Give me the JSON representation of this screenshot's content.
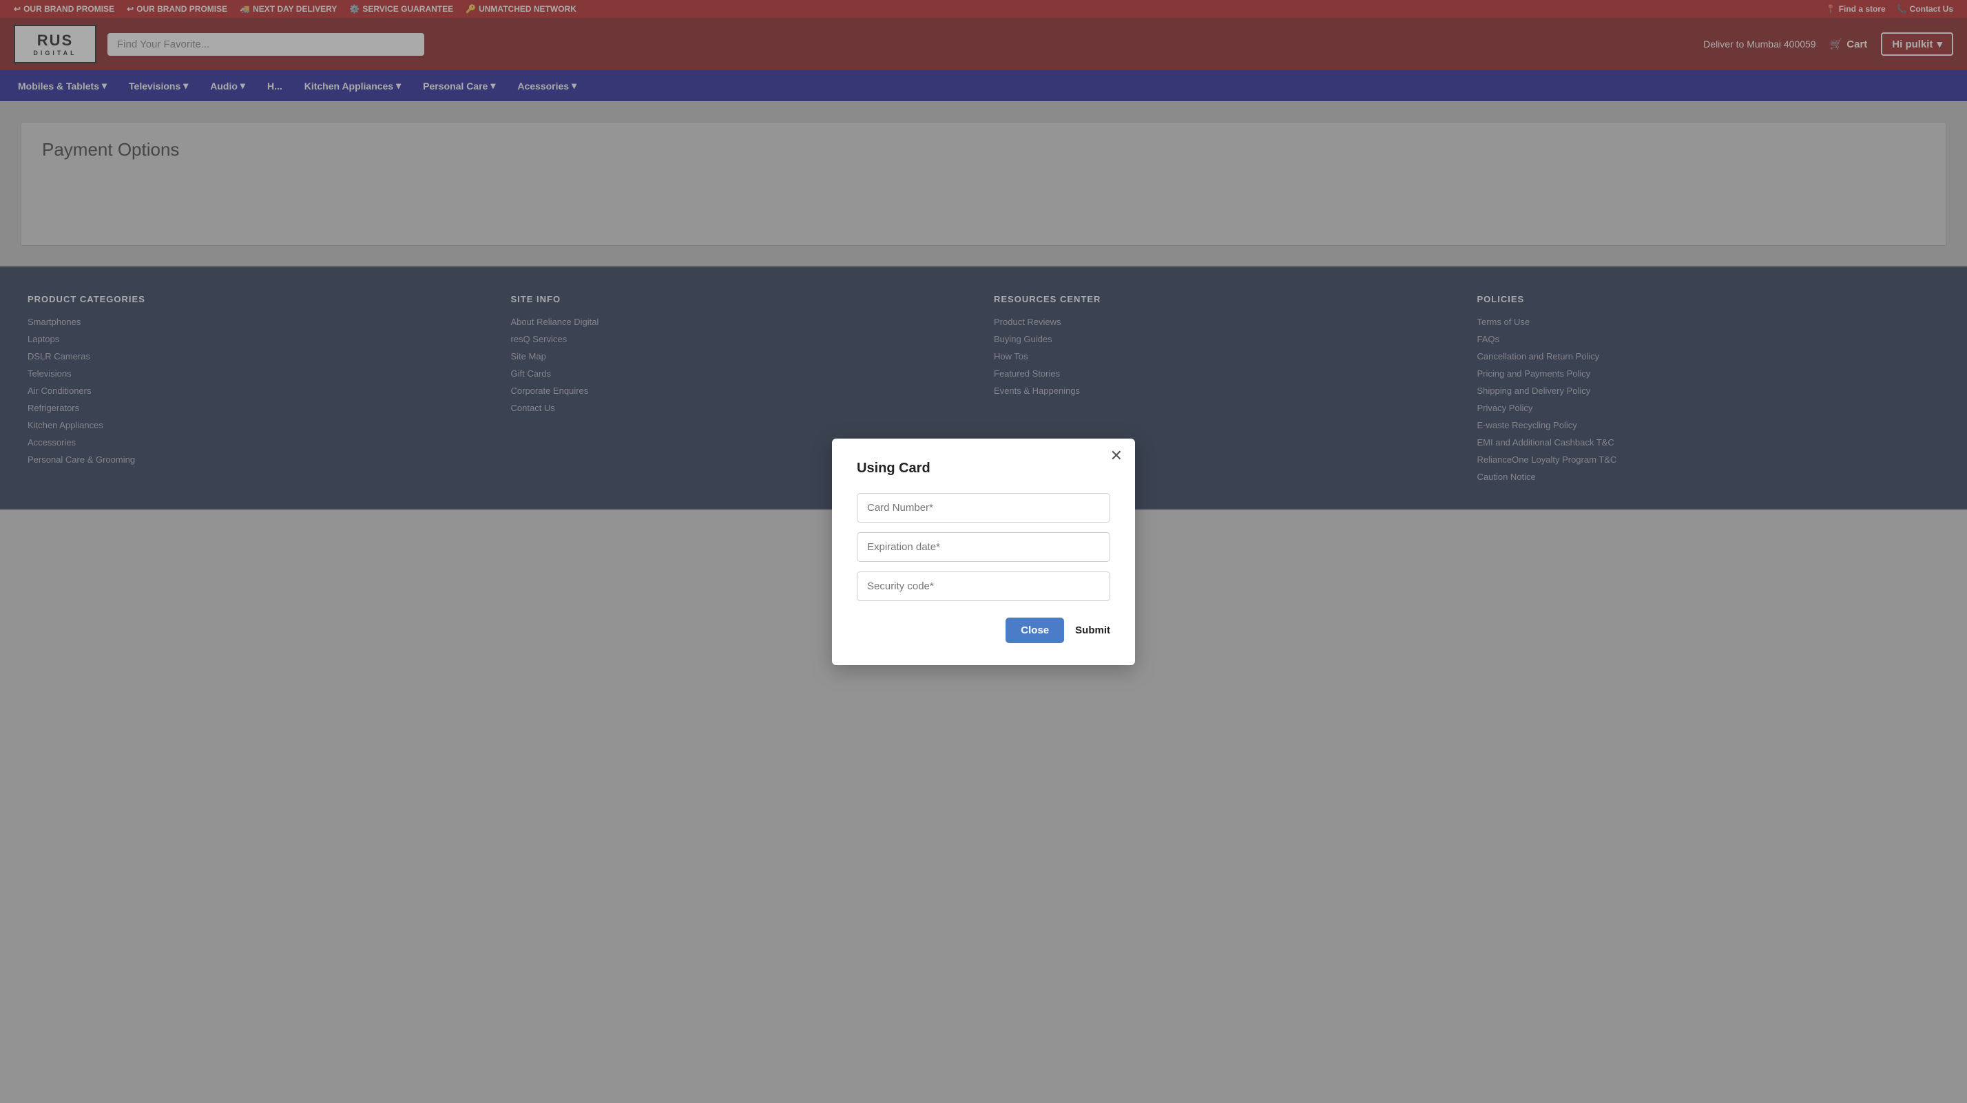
{
  "promoBar": {
    "items": [
      {
        "id": "brand-promise-1",
        "icon": "↩",
        "label": "OUR BRAND PROMISE"
      },
      {
        "id": "brand-promise-2",
        "icon": "↩",
        "label": "OUR BRAND PROMISE"
      },
      {
        "id": "next-day",
        "icon": "🚚",
        "label": "NEXT DAY DELIVERY"
      },
      {
        "id": "service",
        "icon": "⚙️",
        "label": "SERVICE GUARANTEE"
      },
      {
        "id": "network",
        "icon": "🔑",
        "label": "UNMATCHED NETWORK"
      }
    ],
    "rightLinks": [
      {
        "id": "find-store",
        "icon": "📍",
        "label": "Find a store"
      },
      {
        "id": "contact-us-top",
        "icon": "📞",
        "label": "Contact Us"
      }
    ]
  },
  "header": {
    "logo": {
      "brand": "RUS",
      "sub": "DIGITAL"
    },
    "search": {
      "placeholder": "Find Your Favorite..."
    },
    "deliverTo": "Deliver to Mumbai 400059",
    "cartLabel": "Cart",
    "userGreeting": "Hi pulkit"
  },
  "nav": {
    "items": [
      {
        "id": "mobiles",
        "label": "Mobiles & Tablets",
        "hasDropdown": true
      },
      {
        "id": "televisions",
        "label": "Televisions",
        "hasDropdown": true
      },
      {
        "id": "audio",
        "label": "Audio",
        "hasDropdown": true
      },
      {
        "id": "h-placeholder",
        "label": "H...",
        "hasDropdown": false
      },
      {
        "id": "kitchen",
        "label": "Kitchen Appliances",
        "hasDropdown": true
      },
      {
        "id": "personal-care",
        "label": "Personal Care",
        "hasDropdown": true
      },
      {
        "id": "accessories",
        "label": "Acessories",
        "hasDropdown": true
      }
    ]
  },
  "mainContent": {
    "paymentOptionsTitle": "Payment Options"
  },
  "modal": {
    "title": "Using Card",
    "fields": [
      {
        "id": "card-number",
        "placeholder": "Card Number*"
      },
      {
        "id": "expiration-date",
        "placeholder": "Expiration date*"
      },
      {
        "id": "security-code",
        "placeholder": "Security code*"
      }
    ],
    "closeLabel": "Close",
    "submitLabel": "Submit"
  },
  "footer": {
    "columns": [
      {
        "id": "product-categories",
        "heading": "PRODUCT CATEGORIES",
        "items": [
          "Smartphones",
          "Laptops",
          "DSLR Cameras",
          "Televisions",
          "Air Conditioners",
          "Refrigerators",
          "Kitchen Appliances",
          "Accessories",
          "Personal Care & Grooming"
        ]
      },
      {
        "id": "site-info",
        "heading": "SITE INFO",
        "items": [
          "About Reliance Digital",
          "resQ Services",
          "Site Map",
          "Gift Cards",
          "Corporate Enquires",
          "Contact Us"
        ]
      },
      {
        "id": "resources-center",
        "heading": "RESOURCES CENTER",
        "items": [
          "Product Reviews",
          "Buying Guides",
          "How Tos",
          "Featured Stories",
          "Events & Happenings"
        ]
      },
      {
        "id": "policies",
        "heading": "POLICIES",
        "items": [
          "Terms of Use",
          "FAQs",
          "Cancellation and Return Policy",
          "Pricing and Payments Policy",
          "Shipping and Delivery Policy",
          "Privacy Policy",
          "E-waste Recycling Policy",
          "EMI and Additional Cashback T&C",
          "RelianceOne Loyalty Program T&C",
          "Caution Notice"
        ]
      }
    ]
  }
}
